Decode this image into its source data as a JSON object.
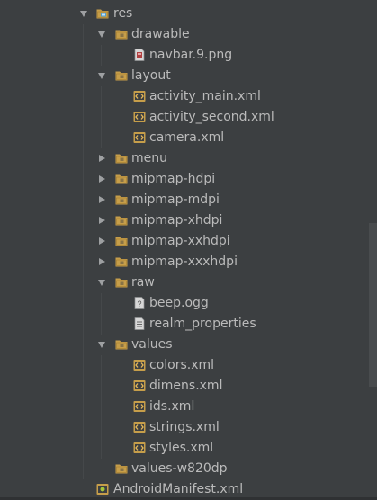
{
  "tree": [
    {
      "label": "res",
      "depth": 0,
      "type": "res-folder",
      "expanded": true
    },
    {
      "label": "drawable",
      "depth": 1,
      "type": "folder",
      "expanded": true
    },
    {
      "label": "navbar.9.png",
      "depth": 2,
      "type": "png-file"
    },
    {
      "label": "layout",
      "depth": 1,
      "type": "folder",
      "expanded": true
    },
    {
      "label": "activity_main.xml",
      "depth": 2,
      "type": "xml-file"
    },
    {
      "label": "activity_second.xml",
      "depth": 2,
      "type": "xml-file"
    },
    {
      "label": "camera.xml",
      "depth": 2,
      "type": "xml-file"
    },
    {
      "label": "menu",
      "depth": 1,
      "type": "folder",
      "expanded": false
    },
    {
      "label": "mipmap-hdpi",
      "depth": 1,
      "type": "folder",
      "expanded": false
    },
    {
      "label": "mipmap-mdpi",
      "depth": 1,
      "type": "folder",
      "expanded": false
    },
    {
      "label": "mipmap-xhdpi",
      "depth": 1,
      "type": "folder",
      "expanded": false
    },
    {
      "label": "mipmap-xxhdpi",
      "depth": 1,
      "type": "folder",
      "expanded": false
    },
    {
      "label": "mipmap-xxxhdpi",
      "depth": 1,
      "type": "folder",
      "expanded": false
    },
    {
      "label": "raw",
      "depth": 1,
      "type": "folder",
      "expanded": true
    },
    {
      "label": "beep.ogg",
      "depth": 2,
      "type": "unknown-file"
    },
    {
      "label": "realm_properties",
      "depth": 2,
      "type": "text-file"
    },
    {
      "label": "values",
      "depth": 1,
      "type": "folder",
      "expanded": true
    },
    {
      "label": "colors.xml",
      "depth": 2,
      "type": "xml-file"
    },
    {
      "label": "dimens.xml",
      "depth": 2,
      "type": "xml-file"
    },
    {
      "label": "ids.xml",
      "depth": 2,
      "type": "xml-file"
    },
    {
      "label": "strings.xml",
      "depth": 2,
      "type": "xml-file"
    },
    {
      "label": "styles.xml",
      "depth": 2,
      "type": "xml-file"
    },
    {
      "label": "values-w820dp",
      "depth": 1,
      "type": "folder"
    },
    {
      "label": "AndroidManifest.xml",
      "depth": 0,
      "type": "manifest-file"
    }
  ],
  "colors": {
    "background": "#3c3f41",
    "text": "#bbbbbb",
    "folder": "#c69e4a",
    "folder_badge": "#4f9ed0"
  }
}
